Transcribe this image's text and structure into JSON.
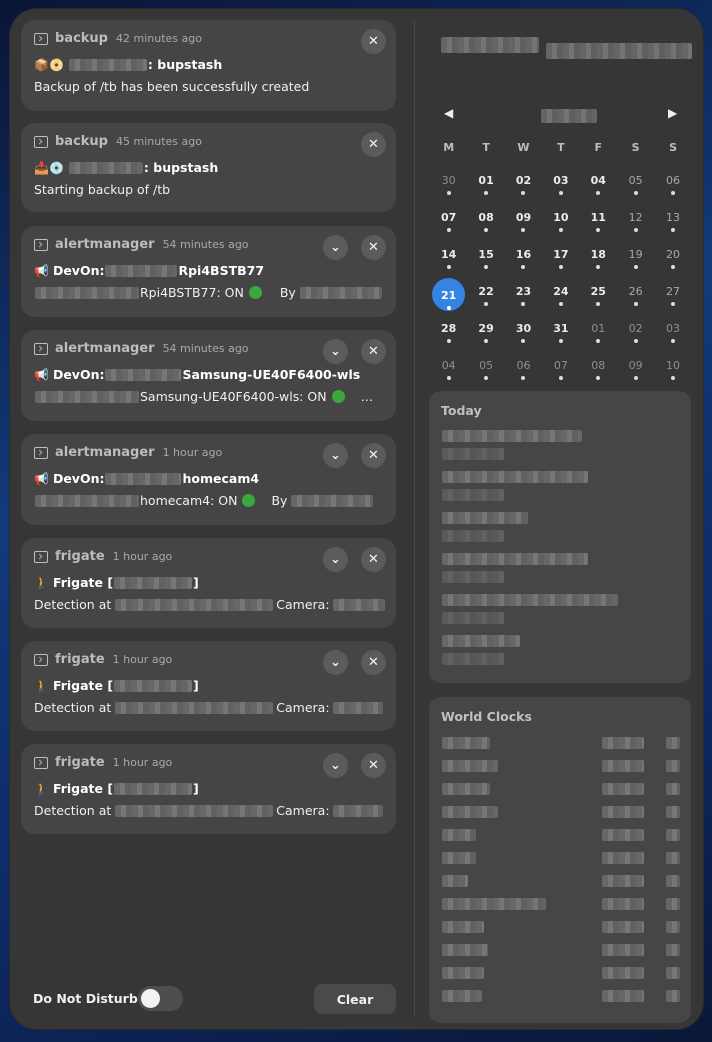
{
  "notifications": [
    {
      "app": "backup",
      "time": "42 minutes ago",
      "emoji": "📦📀",
      "summary": ": bupstash",
      "body": "Backup of /tb has been successfully created",
      "expand": false
    },
    {
      "app": "backup",
      "time": "45 minutes ago",
      "emoji": "📥💿",
      "summary": ": bupstash",
      "body": "Starting backup of /tb",
      "expand": false
    },
    {
      "app": "alertmanager",
      "time": "54 minutes ago",
      "emoji": "📢",
      "summary_prefix": "DevOn:",
      "summary": "Rpi4BSTB77",
      "body_mid": "Rpi4BSTB77: ON",
      "body_tail": "By",
      "expand": true
    },
    {
      "app": "alertmanager",
      "time": "54 minutes ago",
      "emoji": "📢",
      "summary_prefix": "DevOn:",
      "summary": "Samsung-UE40F6400-wls",
      "body_mid": "Samsung-UE40F6400-wls: ON",
      "body_tail": "…",
      "expand": true
    },
    {
      "app": "alertmanager",
      "time": "1 hour ago",
      "emoji": "📢",
      "summary_prefix": "DevOn:",
      "summary": "homecam4",
      "body_mid": "homecam4: ON",
      "body_tail": "By",
      "expand": true
    },
    {
      "app": "frigate",
      "time": "1 hour ago",
      "emoji": "🚶",
      "summary_prefix": "Frigate [",
      "summary": "]",
      "body_mid": "Detection at",
      "body_tail": "Camera:",
      "expand": true
    },
    {
      "app": "frigate",
      "time": "1 hour ago",
      "emoji": "🚶",
      "summary_prefix": "Frigate [",
      "summary": "]",
      "body_mid": "Detection at",
      "body_tail": "Camera:",
      "expand": true
    },
    {
      "app": "frigate",
      "time": "1 hour ago",
      "emoji": "🚶",
      "summary_prefix": "Frigate [",
      "summary": "]",
      "body_mid": "Detection at",
      "body_tail": "Camera:",
      "expand": true
    }
  ],
  "icons": {
    "close": "✕",
    "expand": "⌄",
    "prev": "◀",
    "next": "▶"
  },
  "footer": {
    "dnd_label": "Do Not Disturb",
    "dnd_on": false,
    "clear_label": "Clear"
  },
  "calendar": {
    "weekdays": [
      "M",
      "T",
      "W",
      "T",
      "F",
      "S",
      "S"
    ],
    "today": "21",
    "rows": [
      [
        "30",
        "01",
        "02",
        "03",
        "04",
        "05",
        "06"
      ],
      [
        "07",
        "08",
        "09",
        "10",
        "11",
        "12",
        "13"
      ],
      [
        "14",
        "15",
        "16",
        "17",
        "18",
        "19",
        "20"
      ],
      [
        "21",
        "22",
        "23",
        "24",
        "25",
        "26",
        "27"
      ],
      [
        "28",
        "29",
        "30",
        "31",
        "01",
        "02",
        "03"
      ],
      [
        "04",
        "05",
        "06",
        "07",
        "08",
        "09",
        "10"
      ]
    ]
  },
  "today_section": {
    "title": "Today"
  },
  "world_clocks": {
    "title": "World Clocks"
  },
  "colors": {
    "accent": "#3584e4",
    "panel": "#363636",
    "card": "#464646"
  }
}
